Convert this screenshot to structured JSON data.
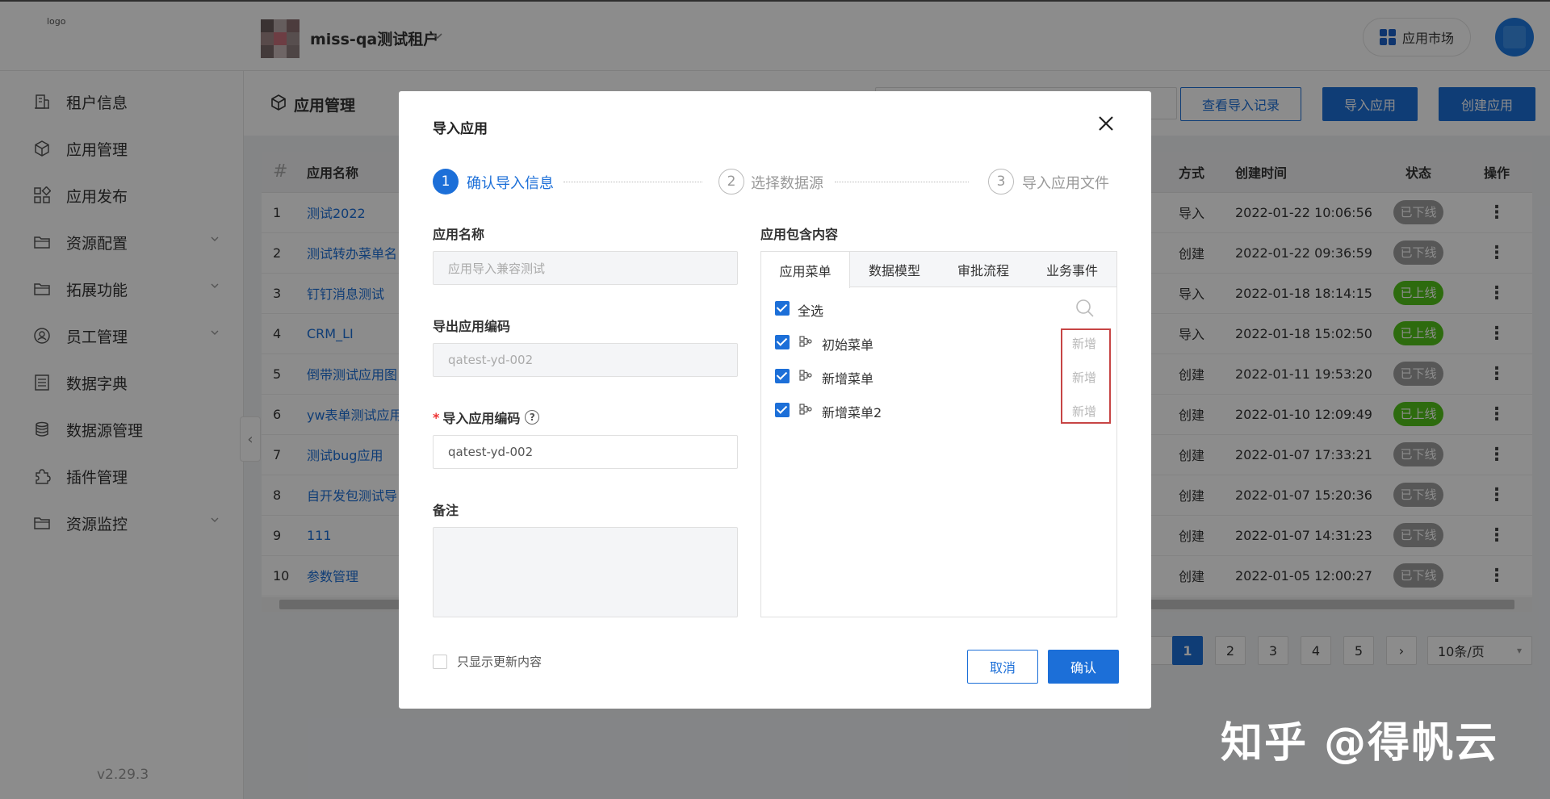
{
  "header": {
    "logo_alt": "logo",
    "tenant_name": "miss-qa测试租户",
    "market_label": "应用市场"
  },
  "sidebar": {
    "items": [
      {
        "label": "租户信息",
        "icon": "building-icon",
        "expandable": false
      },
      {
        "label": "应用管理",
        "icon": "cube-icon",
        "expandable": false
      },
      {
        "label": "应用发布",
        "icon": "apps-icon",
        "expandable": false
      },
      {
        "label": "资源配置",
        "icon": "folder-icon",
        "expandable": true
      },
      {
        "label": "拓展功能",
        "icon": "folder-icon",
        "expandable": true
      },
      {
        "label": "员工管理",
        "icon": "user-circle-icon",
        "expandable": true
      },
      {
        "label": "数据字典",
        "icon": "list-icon",
        "expandable": false
      },
      {
        "label": "数据源管理",
        "icon": "database-icon",
        "expandable": false
      },
      {
        "label": "插件管理",
        "icon": "puzzle-icon",
        "expandable": false
      },
      {
        "label": "资源监控",
        "icon": "folder-icon",
        "expandable": true
      }
    ],
    "version": "v2.29.3"
  },
  "page": {
    "title": "应用管理",
    "buttons": {
      "view_import_records": "查看导入记录",
      "import_app": "导入应用",
      "create_app": "创建应用"
    }
  },
  "table": {
    "headers": {
      "index": "#",
      "name": "应用名称",
      "method": "方式",
      "created": "创建时间",
      "status": "状态",
      "actions": "操作"
    },
    "rows": [
      {
        "index": "1",
        "name": "测试2022",
        "method": "导入",
        "created": "2022-01-22 10:06:56",
        "status": "已下线",
        "online": false
      },
      {
        "index": "2",
        "name": "测试转办菜单名",
        "method": "创建",
        "created": "2022-01-22 09:36:59",
        "status": "已下线",
        "online": false
      },
      {
        "index": "3",
        "name": "钉钉消息测试",
        "method": "导入",
        "created": "2022-01-18 18:14:15",
        "status": "已上线",
        "online": true
      },
      {
        "index": "4",
        "name": "CRM_LI",
        "method": "导入",
        "created": "2022-01-18 15:02:50",
        "status": "已上线",
        "online": true
      },
      {
        "index": "5",
        "name": "倒带测试应用图",
        "method": "创建",
        "created": "2022-01-11 19:53:20",
        "status": "已下线",
        "online": false
      },
      {
        "index": "6",
        "name": "yw表单测试应用",
        "method": "创建",
        "created": "2022-01-10 12:09:49",
        "status": "已上线",
        "online": true
      },
      {
        "index": "7",
        "name": "测试bug应用",
        "method": "创建",
        "created": "2022-01-07 17:33:21",
        "status": "已下线",
        "online": false
      },
      {
        "index": "8",
        "name": "自开发包测试导",
        "method": "创建",
        "created": "2022-01-07 15:20:36",
        "status": "已下线",
        "online": false
      },
      {
        "index": "9",
        "name": "111",
        "method": "创建",
        "created": "2022-01-07 14:31:23",
        "status": "已下线",
        "online": false
      },
      {
        "index": "10",
        "name": "参数管理",
        "method": "创建",
        "created": "2022-01-05 12:00:27",
        "status": "已下线",
        "online": false
      }
    ]
  },
  "pagination": {
    "pages": [
      "1",
      "2",
      "3",
      "4",
      "5"
    ],
    "current": "1",
    "next": "›",
    "page_size": "10条/页"
  },
  "modal": {
    "title": "导入应用",
    "steps": [
      {
        "num": "1",
        "label": "确认导入信息"
      },
      {
        "num": "2",
        "label": "选择数据源"
      },
      {
        "num": "3",
        "label": "导入应用文件"
      }
    ],
    "app_name_label": "应用名称",
    "app_name_placeholder": "应用导入兼容测试",
    "export_code_label": "导出应用编码",
    "export_code_value": "qatest-yd-002",
    "import_code_label": "导入应用编码",
    "import_code_required": "*",
    "import_code_value": "qatest-yd-002",
    "remark_label": "备注",
    "content_label": "应用包含内容",
    "tabs": [
      "应用菜单",
      "数据模型",
      "审批流程",
      "业务事件"
    ],
    "select_all": "全选",
    "menu_items": [
      {
        "label": "初始菜单",
        "status": "新增"
      },
      {
        "label": "新增菜单",
        "status": "新增"
      },
      {
        "label": "新增菜单2",
        "status": "新增"
      }
    ],
    "only_updates_label": "只显示更新内容",
    "cancel": "取消",
    "confirm": "确认"
  },
  "watermark": "知乎 @得帆云",
  "colors": {
    "primary": "#1c6fd8",
    "online": "#52c41a",
    "offline": "#9e9e9e",
    "highlight": "#c74545"
  }
}
